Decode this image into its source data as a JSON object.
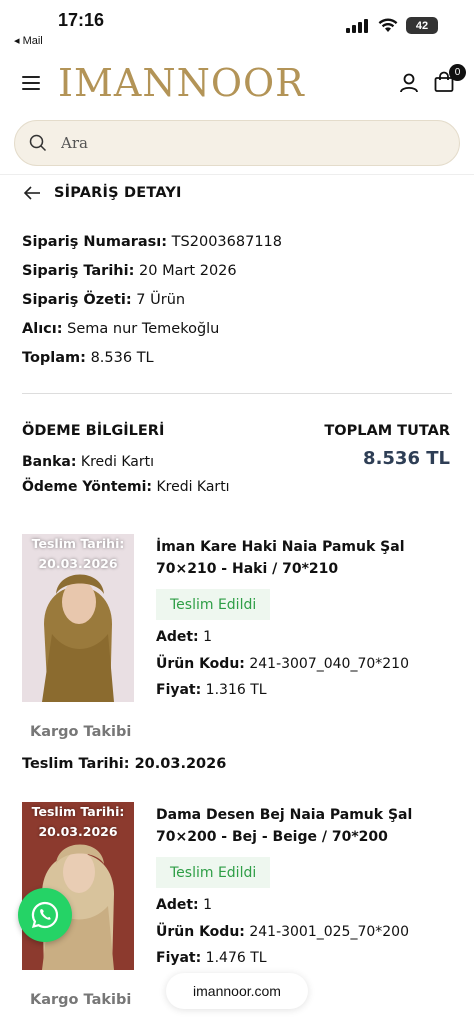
{
  "status_bar": {
    "time": "17:16",
    "back_app": "◂ Mail",
    "battery": "42"
  },
  "header": {
    "logo": "IMANNOOR",
    "cart_count": "0"
  },
  "search": {
    "placeholder": "Ara"
  },
  "page": {
    "title": "SİPARİŞ DETAYI"
  },
  "order": {
    "rows": [
      {
        "label": "Sipariş Numarası:",
        "value": " TS2003687118"
      },
      {
        "label": "Sipariş Tarihi:",
        "value": " 20 Mart 2026"
      },
      {
        "label": "Sipariş Özeti:",
        "value": " 7 Ürün"
      },
      {
        "label": "Alıcı:",
        "value": " Sema nur Temekoğlu"
      },
      {
        "label": "Toplam:",
        "value": " 8.536 TL"
      }
    ]
  },
  "payment": {
    "title": "ÖDEME BİLGİLERİ",
    "bank_label": "Banka:",
    "bank_value": " Kredi Kartı",
    "method_label": "Ödeme Yöntemi:",
    "method_value": " Kredi Kartı",
    "total_label": "TOPLAM TUTAR",
    "total_value": "8.536 TL"
  },
  "products": [
    {
      "image_date_line1": "Teslim Tarihi:",
      "image_date_line2": "20.03.2026",
      "name": "İman Kare Haki Naia Pamuk Şal 70×210 - Haki / 70*210",
      "status": "Teslim Edildi",
      "qty_label": "Adet:",
      "qty": " 1",
      "code_label": "Ürün Kodu:",
      "code": " 241-3007_040_70*210",
      "price_label": "Fiyat:",
      "price": " 1.316 TL",
      "cargo": "Kargo Takibi",
      "delivery": "Teslim Tarihi: 20.03.2026"
    },
    {
      "image_date_line1": "Teslim Tarihi:",
      "image_date_line2": "20.03.2026",
      "name": "Dama Desen Bej Naia Pamuk Şal 70×200 - Bej - Beige / 70*200",
      "status": "Teslim Edildi",
      "qty_label": "Adet:",
      "qty": " 1",
      "code_label": "Ürün Kodu:",
      "code": " 241-3001_025_70*200",
      "price_label": "Fiyat:",
      "price": " 1.476 TL",
      "cargo": "Kargo Takibi"
    }
  ],
  "footer": {
    "url": "imannoor.com"
  },
  "colors": {
    "logo": "#b39457",
    "total": "#2e3e55",
    "status_green": "#2e9e46",
    "whatsapp": "#25d366"
  },
  "icons": [
    "menu-icon",
    "user-icon",
    "shopping-bag-icon",
    "search-icon",
    "arrow-left-icon",
    "whatsapp-icon"
  ]
}
